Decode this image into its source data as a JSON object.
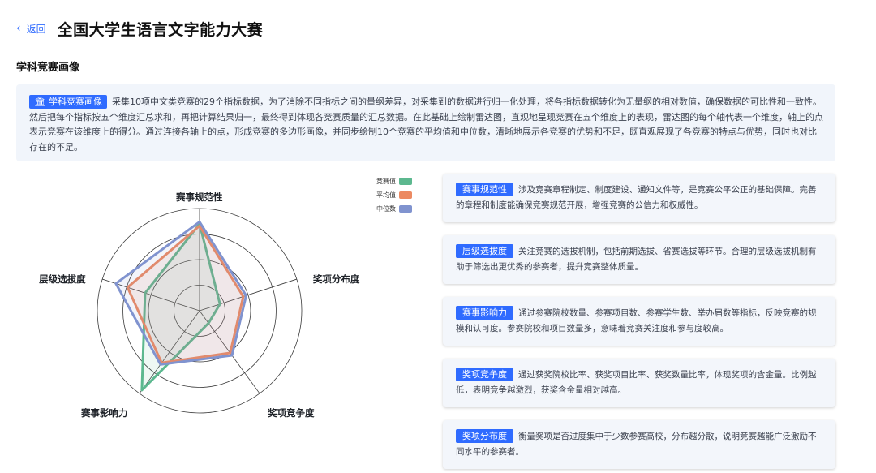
{
  "header": {
    "back_label": "返回",
    "title": "全国大学生语言文字能力大赛"
  },
  "section_title": "学科竞赛画像",
  "intro": {
    "tag_label": "学科竞赛画像",
    "text": "采集10项中文类竞赛的29个指标数据，为了消除不同指标之间的量纲差异，对采集到的数据进行归一化处理，将各指标数据转化为无量纲的相对数值，确保数据的可比性和一致性。然后把每个指标按五个维度汇总求和，再把计算结果归一，最终得到体现各竞赛质量的汇总数据。在此基础上绘制雷达图，直观地呈现竞赛在五个维度上的表现，雷达图的每个轴代表一个维度，轴上的点表示竞赛在该维度上的得分。通过连接各轴上的点，形成竞赛的多边形画像，并同步绘制10个竞赛的平均值和中位数，清晰地展示各竞赛的优势和不足，既直观展现了各竞赛的特点与优势，同时也对比存在的不足。"
  },
  "chart_data": {
    "type": "radar",
    "axes": [
      "赛事规范性",
      "奖项分布度",
      "奖项竞争度",
      "赛事影响力",
      "层级选拔度"
    ],
    "range": [
      0,
      1
    ],
    "rings": 4,
    "series": [
      {
        "name": "竞赛值",
        "color": "#5cb88f",
        "fill": "rgba(92,184,143,0.10)",
        "values": [
          0.85,
          0.21,
          0.15,
          0.96,
          0.56
        ]
      },
      {
        "name": "平均值",
        "color": "#ec8a62",
        "fill": "rgba(236,138,98,0.12)",
        "values": [
          0.83,
          0.45,
          0.51,
          0.63,
          0.74
        ]
      },
      {
        "name": "中位数",
        "color": "#8093cf",
        "fill": "rgba(128,147,207,0.10)",
        "values": [
          0.87,
          0.48,
          0.54,
          0.65,
          0.86
        ]
      }
    ]
  },
  "cards": [
    {
      "tag": "赛事规范性",
      "text": "涉及竞赛章程制定、制度建设、通知文件等，是竞赛公平公正的基础保障。完善的章程和制度能确保竞赛规范开展，增强竞赛的公信力和权威性。"
    },
    {
      "tag": "层级选拔度",
      "text": "关注竞赛的选拔机制，包括前期选拔、省赛选拔等环节。合理的层级选拔机制有助于筛选出更优秀的参赛者，提升竞赛整体质量。"
    },
    {
      "tag": "赛事影响力",
      "text": "通过参赛院校数量、参赛项目数、参赛学生数、举办届数等指标，反映竞赛的规模和认可度。参赛院校和项目数量多，意味着竞赛关注度和参与度较高。"
    },
    {
      "tag": "奖项竞争度",
      "text": "通过获奖院校比率、获奖项目比率、获奖数量比率，体现奖项的含金量。比例越低，表明竞争越激烈，获奖含金量相对越高。"
    },
    {
      "tag": "奖项分布度",
      "text": "衡量奖项是否过度集中于少数参赛高校，分布越分散，说明竞赛越能广泛激励不同水平的参赛者。"
    }
  ],
  "icons": {
    "back": "chevron-left-icon",
    "intro_tag": "building-icon"
  },
  "colors": {
    "accent": "#2f6bff",
    "panel_bg": "#f1f5fb"
  }
}
